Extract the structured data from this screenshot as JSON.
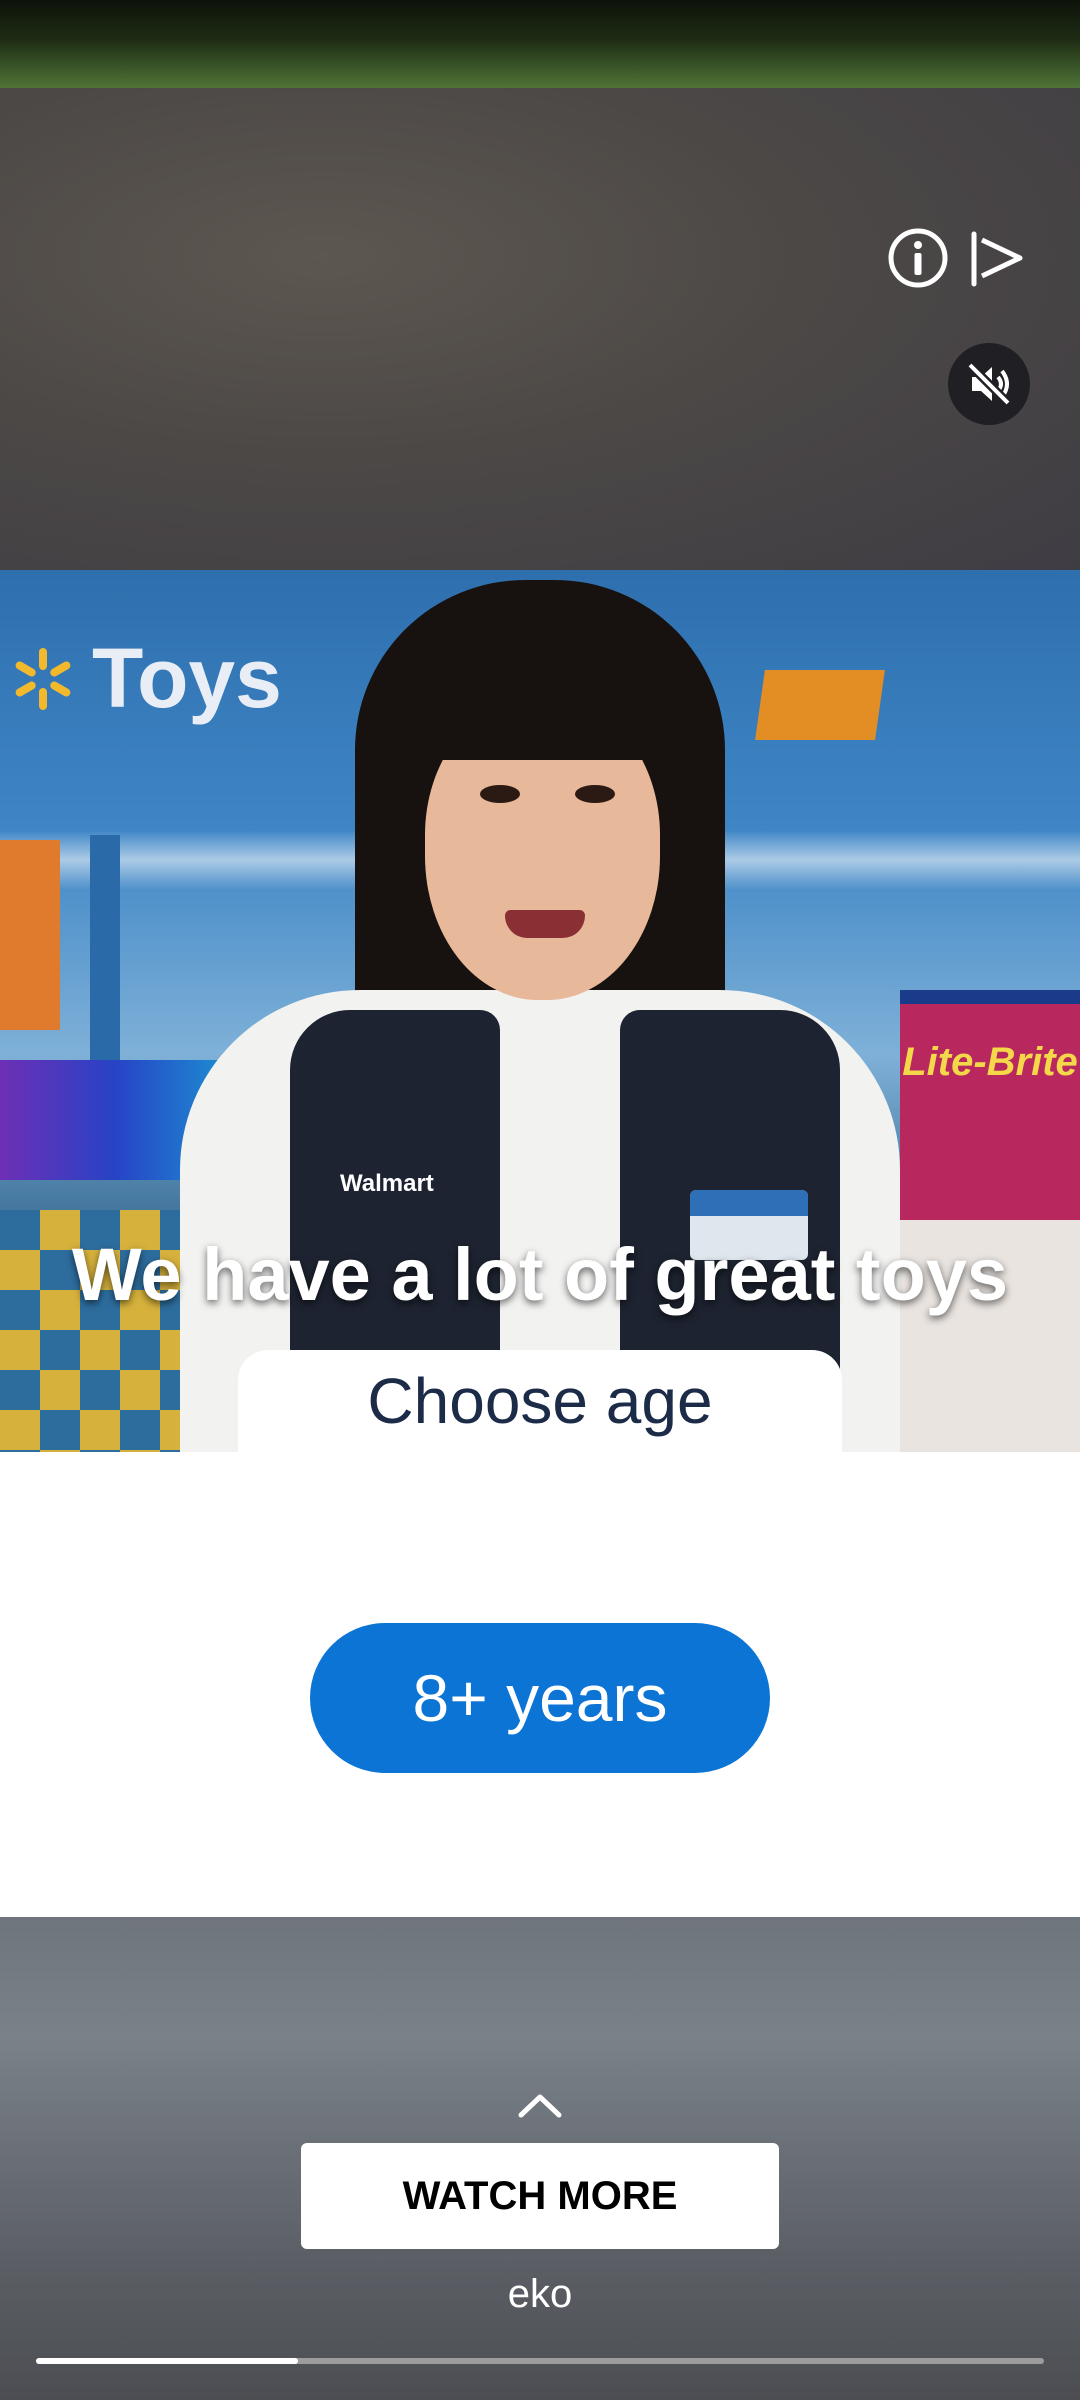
{
  "player": {
    "info_icon": "info-icon",
    "share_icon": "share-play-icon",
    "mute_icon": "muted-speaker-icon",
    "progress_fraction": 0.26
  },
  "video": {
    "store_sign": "Toys",
    "caption": "We have a lot of great toys"
  },
  "interaction": {
    "prompt": "Choose age",
    "option_label": "8+ years",
    "accent_color": "#0b74d4"
  },
  "footer": {
    "expand_icon": "chevron-up-icon",
    "watch_more_label": "WATCH MORE",
    "brand": "eko"
  }
}
